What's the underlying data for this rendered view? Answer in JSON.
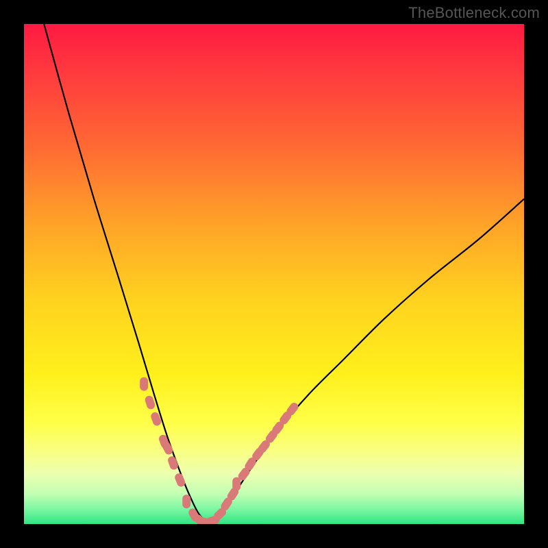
{
  "watermark": "TheBottleneck.com",
  "colors": {
    "black": "#000000",
    "curve": "#000000",
    "marker": "#d97a78",
    "watermark_text": "#565656"
  },
  "gradient_stops": [
    {
      "offset": 0.0,
      "color": "#ff1a42"
    },
    {
      "offset": 0.1,
      "color": "#ff3b3e"
    },
    {
      "offset": 0.25,
      "color": "#ff6b33"
    },
    {
      "offset": 0.4,
      "color": "#ffa328"
    },
    {
      "offset": 0.55,
      "color": "#ffd21f"
    },
    {
      "offset": 0.7,
      "color": "#fff01c"
    },
    {
      "offset": 0.8,
      "color": "#ffff4a"
    },
    {
      "offset": 0.86,
      "color": "#f8ff88"
    },
    {
      "offset": 0.9,
      "color": "#ecffb0"
    },
    {
      "offset": 0.94,
      "color": "#c2ffb3"
    },
    {
      "offset": 0.97,
      "color": "#7cf7a2"
    },
    {
      "offset": 1.0,
      "color": "#2fe583"
    }
  ],
  "chart_data": {
    "type": "line",
    "title": "",
    "xlabel": "",
    "ylabel": "",
    "xlim": [
      0,
      1
    ],
    "ylim": [
      0,
      1
    ],
    "notes": "Coordinates are normalized to the plot area (0=left/top, 1=right/bottom). Curve is a V-shaped bottleneck profile with minimum near x≈0.36. Left branch falls from top-left; right branch rises with a shallower slope reaching y≈0.35 at x=1.",
    "series": [
      {
        "name": "bottleneck-curve",
        "x": [
          0.04,
          0.09,
          0.14,
          0.19,
          0.23,
          0.26,
          0.285,
          0.31,
          0.33,
          0.35,
          0.37,
          0.39,
          0.42,
          0.46,
          0.51,
          0.57,
          0.64,
          0.72,
          0.81,
          0.91,
          1.0
        ],
        "y": [
          0.0,
          0.18,
          0.35,
          0.51,
          0.64,
          0.74,
          0.82,
          0.89,
          0.94,
          0.98,
          0.995,
          0.98,
          0.94,
          0.88,
          0.81,
          0.74,
          0.67,
          0.59,
          0.51,
          0.43,
          0.35
        ]
      },
      {
        "name": "marker-cluster-left",
        "type": "scatter",
        "x": [
          0.24,
          0.252,
          0.264,
          0.28,
          0.287,
          0.298,
          0.312
        ],
        "y": [
          0.72,
          0.757,
          0.79,
          0.835,
          0.848,
          0.878,
          0.912
        ]
      },
      {
        "name": "marker-cluster-valley",
        "type": "scatter",
        "x": [
          0.325,
          0.34,
          0.352,
          0.365,
          0.378,
          0.392,
          0.405,
          0.418
        ],
        "y": [
          0.955,
          0.982,
          0.993,
          0.997,
          0.993,
          0.98,
          0.96,
          0.94
        ]
      },
      {
        "name": "marker-cluster-right",
        "type": "scatter",
        "x": [
          0.425,
          0.44,
          0.453,
          0.468,
          0.48,
          0.495,
          0.508,
          0.523,
          0.537
        ],
        "y": [
          0.92,
          0.9,
          0.88,
          0.86,
          0.845,
          0.825,
          0.808,
          0.788,
          0.77
        ]
      }
    ]
  }
}
